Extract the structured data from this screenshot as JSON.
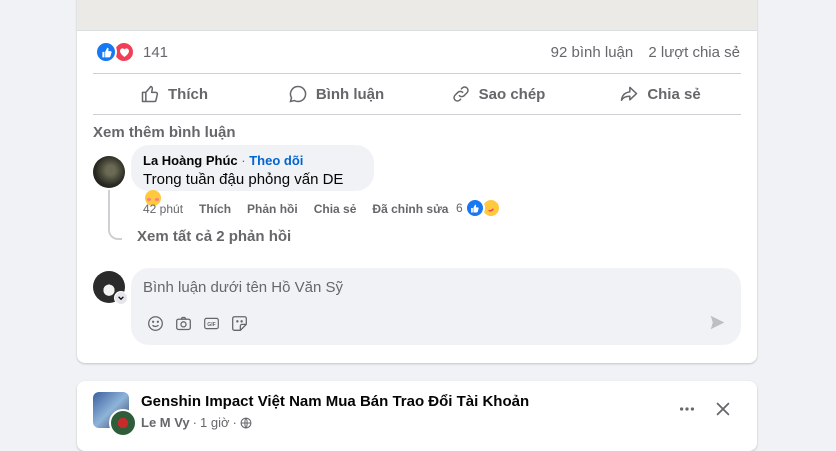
{
  "post": {
    "reaction_count": "141",
    "comments_count": "92 bình luận",
    "shares_count": "2 lượt chia sẻ",
    "reaction_icons": [
      "like-icon",
      "love-icon"
    ],
    "actions": {
      "like": "Thích",
      "comment": "Bình luận",
      "copy": "Sao chép",
      "share": "Chia sẻ"
    },
    "see_more_comments": "Xem thêm bình luận"
  },
  "comment": {
    "author": "La Hoàng Phúc",
    "separator": "·",
    "follow": "Theo dõi",
    "text": "Trong tuần đậu phỏng vấn DE",
    "emoji": "smiling-face-with-hearts-icon",
    "time": "42 phút",
    "like": "Thích",
    "reply": "Phản hồi",
    "share": "Chia sẻ",
    "edited": "Đã chỉnh sửa",
    "reaction_count": "6",
    "reaction_icons": [
      "like-icon",
      "care-icon"
    ],
    "view_replies": "Xem tất cả 2 phản hồi"
  },
  "composer": {
    "placeholder": "Bình luận dưới tên Hồ Văn Sỹ",
    "tools": [
      "emoji-icon",
      "camera-icon",
      "gif-icon",
      "sticker-icon"
    ],
    "send_icon": "send-icon"
  },
  "next_post": {
    "group_name": "Genshin Impact Việt Nam Mua Bán Trao Đổi Tài Khoản",
    "author": "Le M Vy",
    "separator": "·",
    "time": "1 giờ",
    "separator2": "·",
    "privacy_icon": "globe-icon"
  },
  "colors": {
    "like_blue": "#1877f2",
    "love_red": "#f33e58",
    "link_blue": "#0064d1",
    "secondary_text": "#65676b",
    "background": "#f0f2f5"
  }
}
